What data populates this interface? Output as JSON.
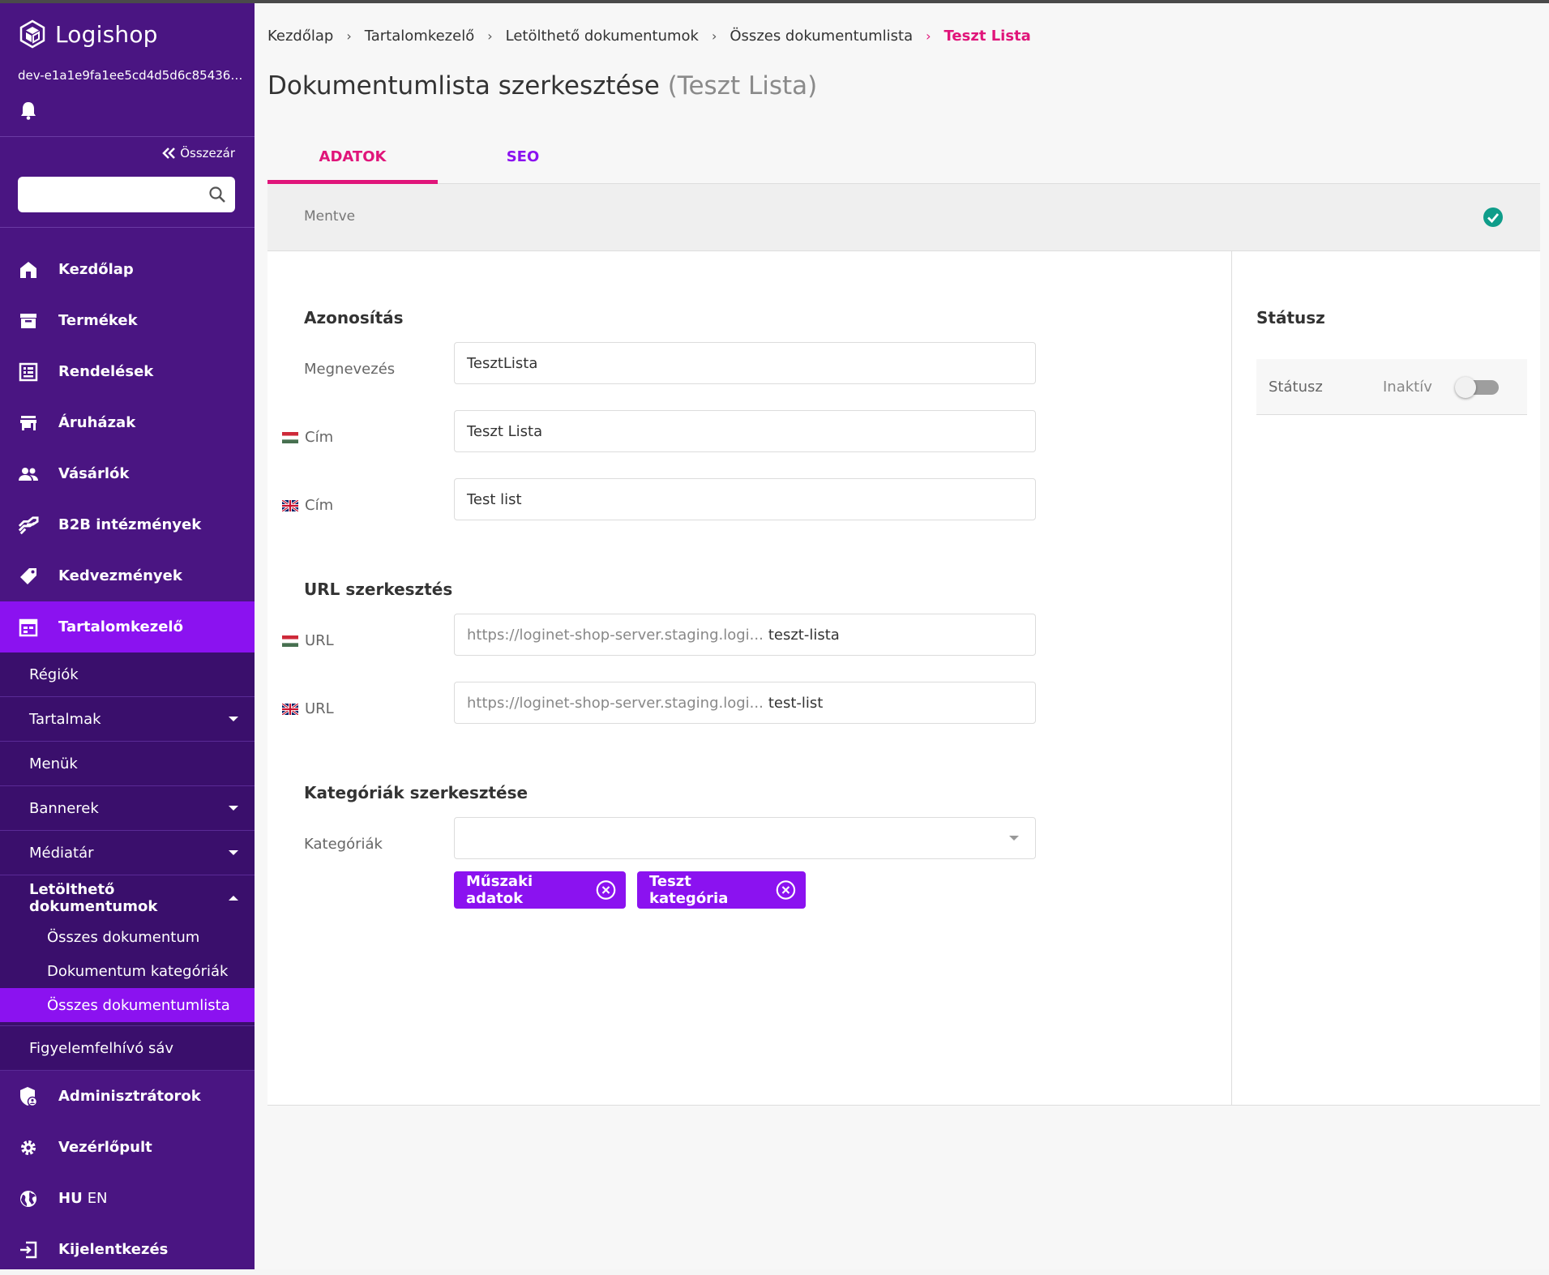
{
  "colors": {
    "sidebar_bg": "#4a1582",
    "sidebar_active": "#8b12f0",
    "accent_pink": "#e0157a",
    "accent_purple": "#8b12f0",
    "success": "#0f9d8a"
  },
  "sidebar": {
    "brand": "Logishop",
    "instance": "dev-e1a1e9fa1ee5cd4d5d6c85436aa...",
    "collapse_label": "Összezár",
    "search": {
      "placeholder": "",
      "value": ""
    },
    "nav": [
      {
        "label": "Kezdőlap",
        "icon": "home-icon"
      },
      {
        "label": "Termékek",
        "icon": "archive-box-icon"
      },
      {
        "label": "Rendelések",
        "icon": "receipt-list-icon"
      },
      {
        "label": "Áruházak",
        "icon": "store-icon"
      },
      {
        "label": "Vásárlók",
        "icon": "people-icon"
      },
      {
        "label": "B2B intézmények",
        "icon": "handshake-icon"
      },
      {
        "label": "Kedvezmények",
        "icon": "tag-icon"
      },
      {
        "label": "Tartalomkezelő",
        "icon": "content-calendar-icon"
      }
    ],
    "content_sub": [
      {
        "label": "Régiók"
      },
      {
        "label": "Tartalmak"
      },
      {
        "label": "Menük"
      },
      {
        "label": "Bannerek"
      },
      {
        "label": "Médiatár"
      },
      {
        "label": "Letölthető dokumentumok"
      }
    ],
    "documents_sub": [
      {
        "label": "Összes dokumentum"
      },
      {
        "label": "Dokumentum kategóriák"
      },
      {
        "label": "Összes dokumentumlista"
      }
    ],
    "alert_bar": "Figyelemfelhívó sáv",
    "bottom_nav": [
      {
        "label": "Adminisztrátorok",
        "icon": "admin-shield-icon"
      },
      {
        "label": "Vezérlőpult",
        "icon": "gear-icon"
      },
      {
        "label_a": "HU",
        "label_b": "EN",
        "icon": "globe-icon"
      },
      {
        "label": "Kijelentkezés",
        "icon": "logout-icon"
      }
    ]
  },
  "breadcrumb": [
    "Kezdőlap",
    "Tartalomkezelő",
    "Letölthető dokumentumok",
    "Összes dokumentumlista",
    "Teszt Lista"
  ],
  "page": {
    "title": "Dokumentumlista szerkesztése",
    "subtitle": "(Teszt Lista)"
  },
  "tabs": [
    "ADATOK",
    "SEO"
  ],
  "save_status": "Mentve",
  "form": {
    "identification": {
      "title": "Azonosítás",
      "name_label": "Megnevezés",
      "name_value": "TesztLista",
      "title_hu_label": "Cím",
      "title_hu_value": "Teszt Lista",
      "title_en_label": "Cím",
      "title_en_value": "Test list"
    },
    "url": {
      "title": "URL szerkesztés",
      "hu_label": "URL",
      "hu_prefix": "https://loginet-shop-server.staging.logi...",
      "hu_value": "teszt-lista",
      "en_label": "URL",
      "en_prefix": "https://loginet-shop-server.staging.logi...",
      "en_value": "test-list"
    },
    "categories": {
      "title": "Kategóriák szerkesztése",
      "label": "Kategóriák",
      "value": "",
      "chips": [
        "Műszaki adatok",
        "Teszt kategória"
      ]
    }
  },
  "status_panel": {
    "title": "Státusz",
    "row_label": "Státusz",
    "row_value": "Inaktív",
    "active": false
  }
}
